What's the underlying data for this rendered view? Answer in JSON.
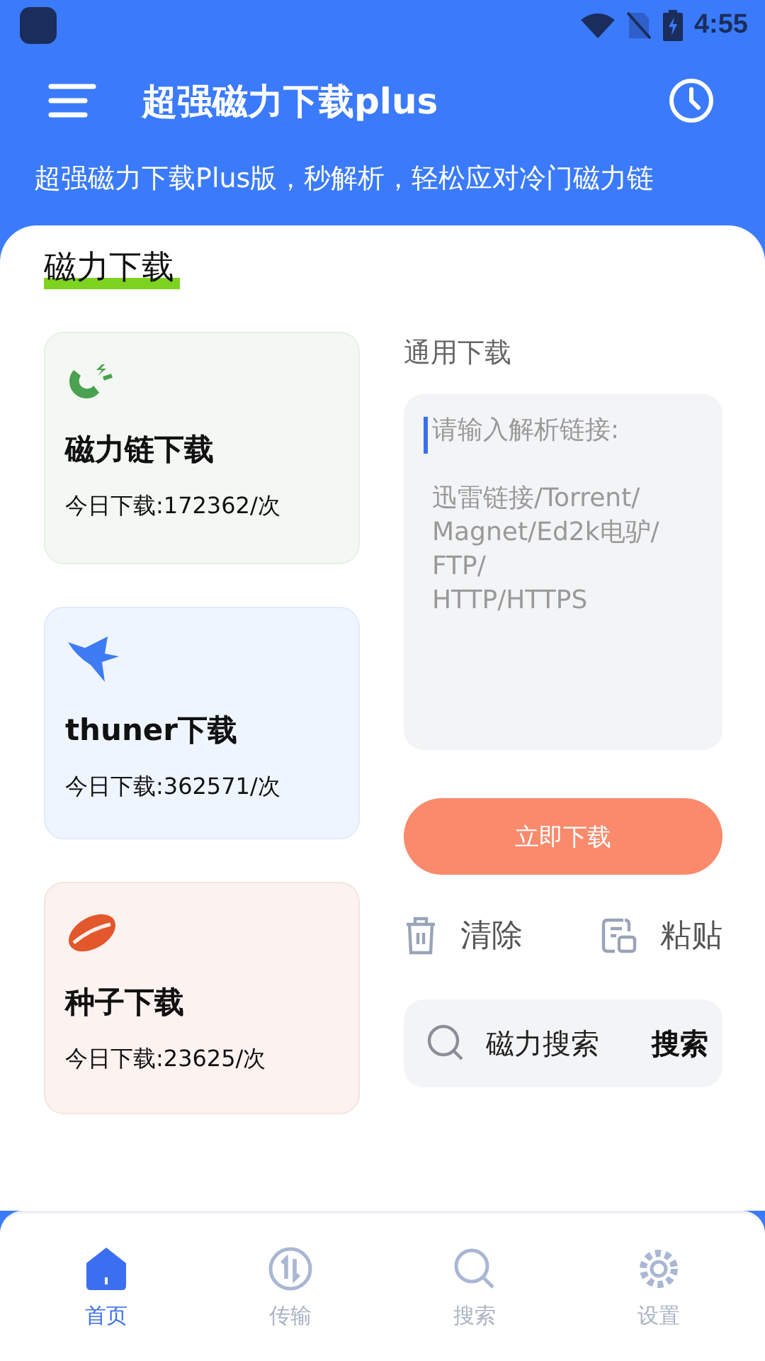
{
  "status_bar": {
    "time": "4:55"
  },
  "app_bar": {
    "title": "超强磁力下载plus",
    "subtitle": "超强磁力下载Plus版，秒解析，轻松应对冷门磁力链"
  },
  "section": {
    "title": "磁力下载"
  },
  "cards": [
    {
      "kind": "magnet",
      "title": "磁力链下载",
      "count": "今日下载:172362/次"
    },
    {
      "kind": "bird",
      "title": "thuner下载",
      "count": "今日下载:362571/次"
    },
    {
      "kind": "seed",
      "title": "种子下载",
      "count": "今日下载:23625/次"
    }
  ],
  "general": {
    "label": "通用下载",
    "placeholder": "请输入解析链接:\n\n迅雷链接/Torrent/\nMagnet/Ed2k电驴/\nFTP/\nHTTP/HTTPS",
    "button": "立即下载"
  },
  "actions": [
    {
      "kind": "clear",
      "label": "清除"
    },
    {
      "kind": "paste",
      "label": "粘贴"
    }
  ],
  "search": {
    "label": "磁力搜索",
    "button": "搜索"
  },
  "nav": [
    {
      "kind": "home",
      "label": "首页",
      "selected": true
    },
    {
      "kind": "transfer",
      "label": "传输",
      "selected": false
    },
    {
      "kind": "search",
      "label": "搜索",
      "selected": false
    },
    {
      "kind": "settings",
      "label": "设置",
      "selected": false
    }
  ]
}
